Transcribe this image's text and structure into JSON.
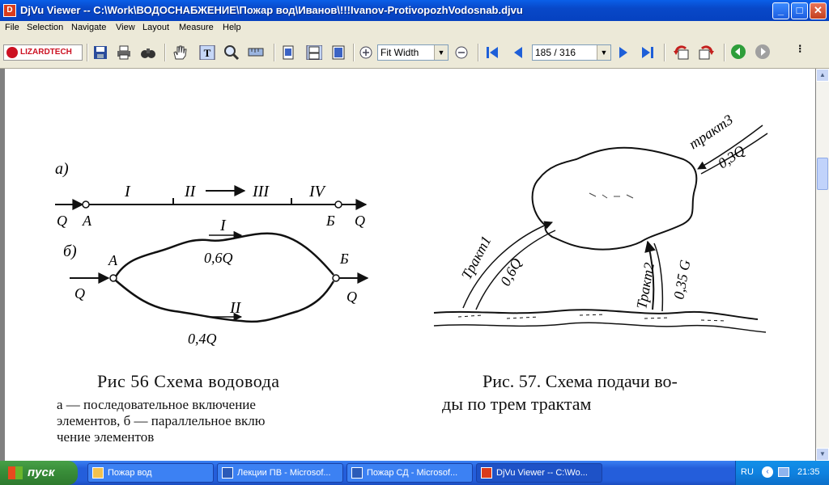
{
  "window": {
    "title": "DjVu Viewer -- C:\\Work\\ВОДОСНАБЖЕНИЕ\\Пожар вод\\Иванов\\!!!Ivanov-ProtivopozhVodosnab.djvu",
    "buttons": {
      "minimize": "_",
      "maximize": "□",
      "close": "✕"
    }
  },
  "menu": [
    "File",
    "Selection",
    "Navigate",
    "View",
    "Layout",
    "Measure",
    "Help"
  ],
  "toolbar": {
    "brand": "LIZARDTECH",
    "zoom": "Fit Width",
    "page": "185 / 316",
    "overflow": "⁝"
  },
  "figure56": {
    "part_a": "а)",
    "part_b": "б)",
    "seg_1": "I",
    "seg_2": "II",
    "seg_3": "III",
    "seg_4": "IV",
    "flow_in": "Q",
    "flow_out": "Q",
    "node_a": "А",
    "node_b": "Б",
    "branch_1": "I",
    "branch_1_flow": "0,6Q",
    "branch_2": "II",
    "branch_2_flow": "0,4Q",
    "caption_title": "Рис  56  Схема водовода",
    "caption_line1": "а —  последовательное   включение",
    "caption_line2": "элементов, б — параллельное вклю",
    "caption_line3": "чение  элементов"
  },
  "figure57": {
    "tract_1": "Тракт1",
    "tract_1_flow": "0,6Q",
    "tract_2": "Тракт2",
    "tract_2_flow": "0,35 G",
    "tract_3": "тракт3",
    "tract_3_flow": "0,3Q",
    "caption_line1": "Рис. 57. Схема подачи во-",
    "caption_line2": "ды по трем трактам"
  },
  "taskbar": {
    "start": "пуск",
    "tasks": [
      "Пожар вод",
      "Лекции ПВ - Microsof...",
      "Пожар СД - Microsof...",
      "DjVu Viewer -- C:\\Wo..."
    ],
    "lang": "RU",
    "time": "21:35"
  },
  "colors": {
    "titlebar": "#0848C8",
    "taskbar": "#245EDB",
    "start": "#3A8F3A"
  }
}
